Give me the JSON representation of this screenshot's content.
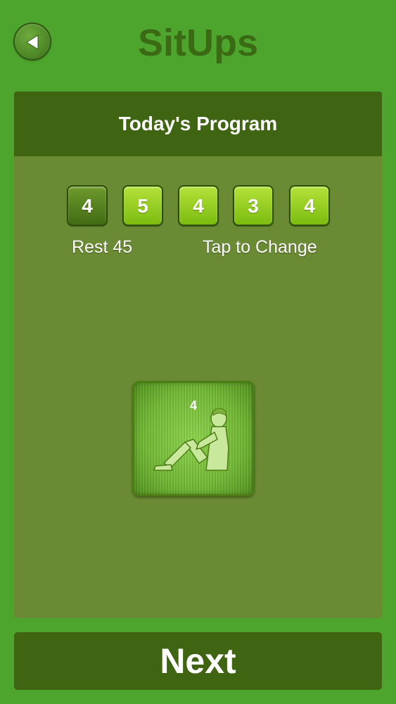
{
  "header": {
    "title": "SitUps",
    "back_icon": "back-arrow-icon"
  },
  "program": {
    "title": "Today's Program",
    "sets": [
      "4",
      "5",
      "4",
      "3",
      "4"
    ],
    "active_set_index": 0,
    "rest_label": "Rest 45",
    "change_hint": "Tap to Change"
  },
  "exercise": {
    "count": "4",
    "icon": "situp-figure-icon"
  },
  "footer": {
    "next_label": "Next"
  },
  "colors": {
    "background": "#4ea52e",
    "panel": "#6a8a33",
    "panel_header": "#3f6412",
    "set_box": "#9bd122",
    "set_box_active": "#5a8520",
    "title": "#3a6a14"
  }
}
